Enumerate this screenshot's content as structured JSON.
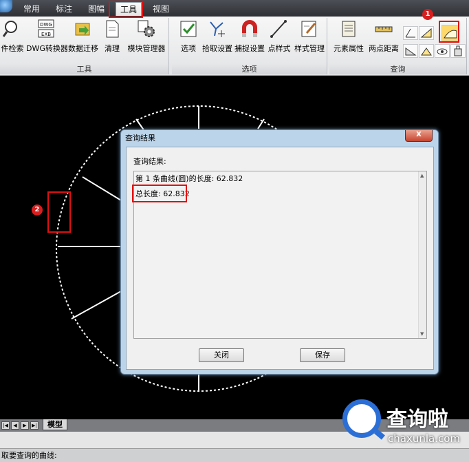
{
  "tabs": [
    {
      "label": "常用"
    },
    {
      "label": "标注"
    },
    {
      "label": "图幅"
    },
    {
      "label": "工具",
      "active": true
    },
    {
      "label": "视图"
    }
  ],
  "ribbon": {
    "groups": [
      {
        "label": "工具",
        "buttons": [
          "件检索",
          "DWG转换器",
          "数据迁移",
          "清理",
          "模块管理器"
        ]
      },
      {
        "label": "选项",
        "buttons": [
          "选项",
          "拾取设置",
          "捕捉设置",
          "点样式",
          "样式管理"
        ]
      },
      {
        "label": "查询",
        "buttons": [
          "元素属性",
          "两点距离"
        ]
      }
    ],
    "dwg_icon_text": [
      "DWG",
      "EXB"
    ]
  },
  "dialog": {
    "title": "查询结果",
    "result_label": "查询结果:",
    "lines": [
      "第 1 条曲线(圆)的长度: 62.832",
      "总长度: 62.832"
    ],
    "close_label": "关闭",
    "save_label": "保存"
  },
  "annotations": {
    "badge1": "1",
    "badge2": "2"
  },
  "layout_tab": "模型",
  "nav_arrows": [
    "|◀",
    "◀",
    "▶",
    "▶|"
  ],
  "status_text": "取要查询的曲线:",
  "watermark": {
    "cn": "查询啦",
    "en": "chaxunla.com"
  },
  "colors": {
    "accent": "#e01010",
    "dialog_frame": "#bcd4ea",
    "canvas": "#000000",
    "drawing": "#ffffff"
  }
}
